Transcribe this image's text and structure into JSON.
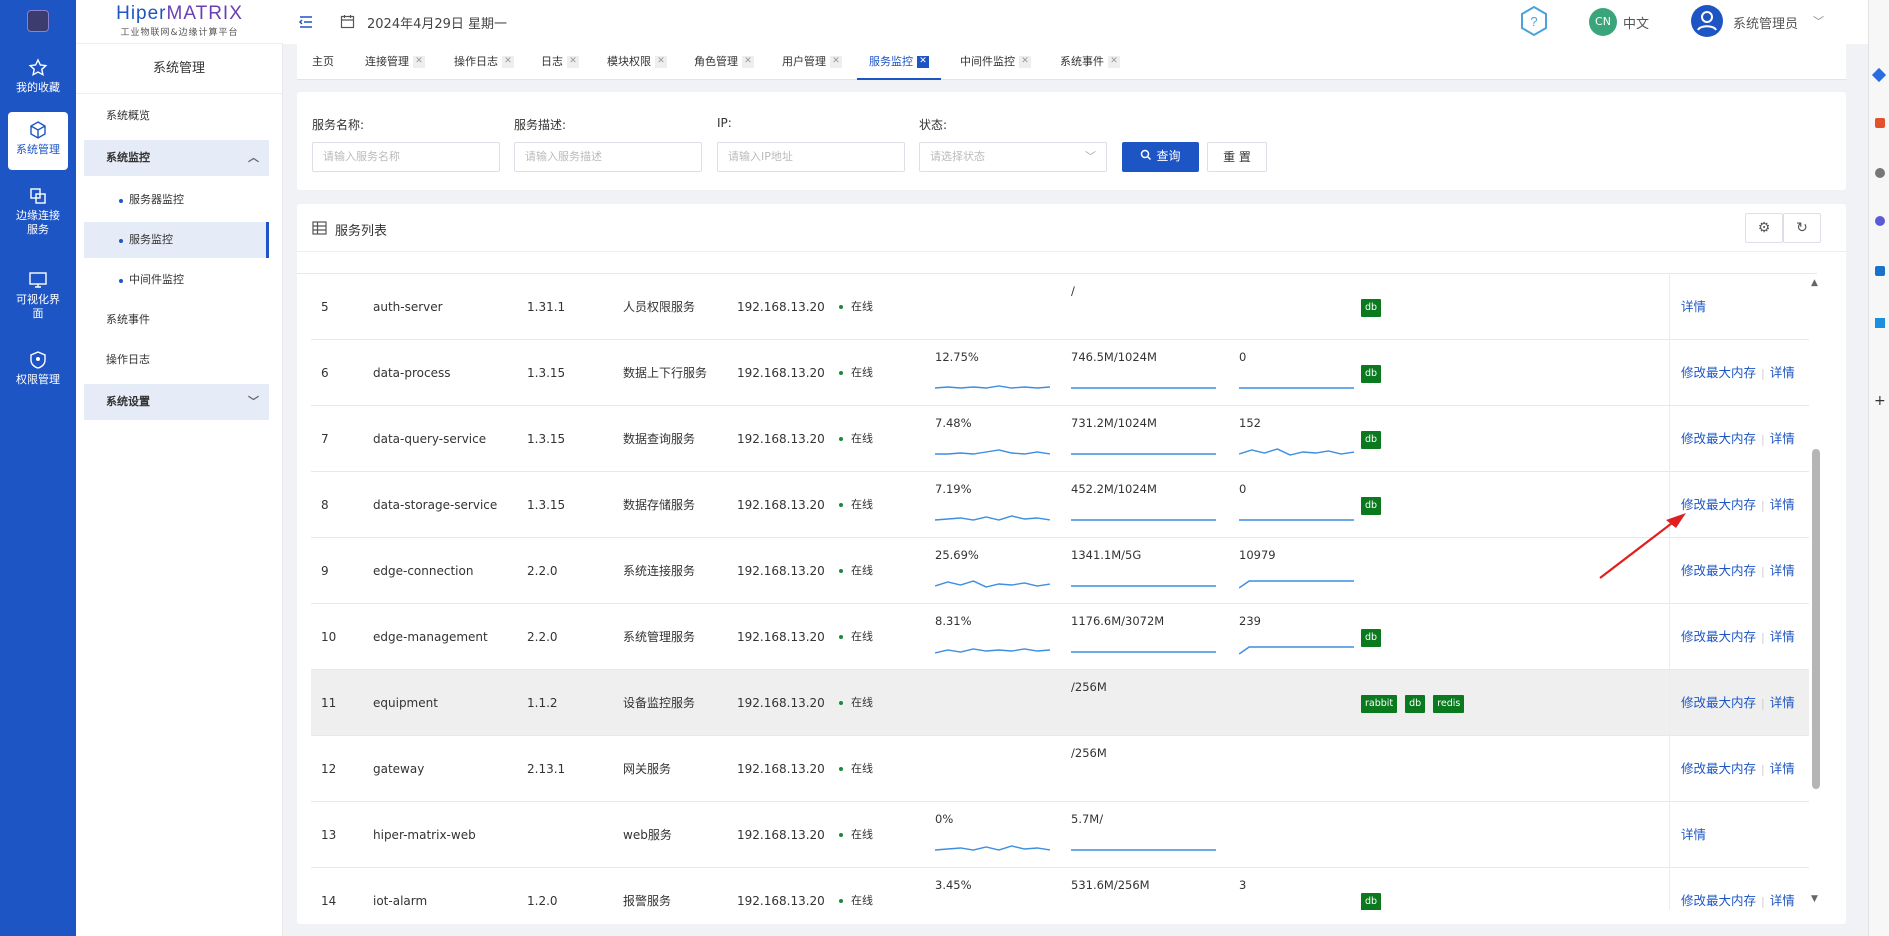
{
  "brand": {
    "name_a": "Hiper",
    "name_b": "MATRIX",
    "subtitle": "工业物联网&边缘计算平台"
  },
  "rail": [
    {
      "label": "我的收藏",
      "icon": "star-icon"
    },
    {
      "label": "系统管理",
      "icon": "cube-icon"
    },
    {
      "label": "边缘连接服务",
      "icon": "link-icon"
    },
    {
      "label": "可视化界面",
      "icon": "monitor-icon"
    },
    {
      "label": "权限管理",
      "icon": "shield-icon"
    }
  ],
  "sidebar": {
    "title": "系统管理",
    "items": [
      "系统概览",
      "系统监控",
      "服务器监控",
      "服务监控",
      "中间件监控",
      "系统事件",
      "操作日志",
      "系统设置"
    ]
  },
  "topbar": {
    "date": "2024年4月29日 星期一",
    "lang_badge": "CN",
    "lang": "中文",
    "user": "系统管理员"
  },
  "tabs": [
    "主页",
    "连接管理",
    "操作日志",
    "日志",
    "模块权限",
    "角色管理",
    "用户管理",
    "服务监控",
    "中间件监控",
    "系统事件"
  ],
  "search": {
    "name_label": "服务名称:",
    "name_placeholder": "请输入服务名称",
    "desc_label": "服务描述:",
    "desc_placeholder": "请输入服务描述",
    "ip_label": "IP:",
    "ip_placeholder": "请输入IP地址",
    "status_label": "状态:",
    "status_placeholder": "请选择状态",
    "query": "查询",
    "reset": "重 置"
  },
  "list": {
    "title": "服务列表",
    "rows": [
      {
        "no": "5",
        "name": "auth-server",
        "ver": "1.31.1",
        "desc": "人员权限服务",
        "ip": "192.168.13.20",
        "status": "在线",
        "cpu": "",
        "mem": "/",
        "thr": "",
        "tags": [
          "db"
        ],
        "modify": "",
        "detail": "详情"
      },
      {
        "no": "6",
        "name": "data-process",
        "ver": "1.3.15",
        "desc": "数据上下行服务",
        "ip": "192.168.13.20",
        "status": "在线",
        "cpu": "12.75%",
        "mem": "746.5M/1024M",
        "thr": "0",
        "tags": [
          "db"
        ],
        "modify": "修改最大内存",
        "detail": "详情"
      },
      {
        "no": "7",
        "name": "data-query-service",
        "ver": "1.3.15",
        "desc": "数据查询服务",
        "ip": "192.168.13.20",
        "status": "在线",
        "cpu": "7.48%",
        "mem": "731.2M/1024M",
        "thr": "152",
        "tags": [
          "db"
        ],
        "modify": "修改最大内存",
        "detail": "详情"
      },
      {
        "no": "8",
        "name": "data-storage-service",
        "ver": "1.3.15",
        "desc": "数据存储服务",
        "ip": "192.168.13.20",
        "status": "在线",
        "cpu": "7.19%",
        "mem": "452.2M/1024M",
        "thr": "0",
        "tags": [
          "db"
        ],
        "modify": "修改最大内存",
        "detail": "详情"
      },
      {
        "no": "9",
        "name": "edge-connection",
        "ver": "2.2.0",
        "desc": "系统连接服务",
        "ip": "192.168.13.20",
        "status": "在线",
        "cpu": "25.69%",
        "mem": "1341.1M/5G",
        "thr": "10979",
        "tags": [],
        "modify": "修改最大内存",
        "detail": "详情"
      },
      {
        "no": "10",
        "name": "edge-management",
        "ver": "2.2.0",
        "desc": "系统管理服务",
        "ip": "192.168.13.20",
        "status": "在线",
        "cpu": "8.31%",
        "mem": "1176.6M/3072M",
        "thr": "239",
        "tags": [
          "db"
        ],
        "modify": "修改最大内存",
        "detail": "详情"
      },
      {
        "no": "11",
        "name": "equipment",
        "ver": "1.1.2",
        "desc": "设备监控服务",
        "ip": "192.168.13.20",
        "status": "在线",
        "cpu": "",
        "mem": "/256M",
        "thr": "",
        "tags": [
          "rabbit",
          "db",
          "redis"
        ],
        "modify": "修改最大内存",
        "detail": "详情"
      },
      {
        "no": "12",
        "name": "gateway",
        "ver": "2.13.1",
        "desc": "网关服务",
        "ip": "192.168.13.20",
        "status": "在线",
        "cpu": "",
        "mem": "/256M",
        "thr": "",
        "tags": [],
        "modify": "修改最大内存",
        "detail": "详情"
      },
      {
        "no": "13",
        "name": "hiper-matrix-web",
        "ver": "",
        "desc": "web服务",
        "ip": "192.168.13.20",
        "status": "在线",
        "cpu": "0%",
        "mem": "5.7M/",
        "thr": "",
        "tags": [],
        "modify": "",
        "detail": "详情"
      },
      {
        "no": "14",
        "name": "iot-alarm",
        "ver": "1.2.0",
        "desc": "报警服务",
        "ip": "192.168.13.20",
        "status": "在线",
        "cpu": "3.45%",
        "mem": "531.6M/256M",
        "thr": "3",
        "tags": [
          "db"
        ],
        "modify": "修改最大内存",
        "detail": "详情"
      }
    ]
  },
  "colors": {
    "primary": "#1d55c4",
    "online": "#1a8a3a",
    "tag": "#0b7a1f",
    "spark": "#3d8fe0",
    "arrow": "#e02020"
  }
}
